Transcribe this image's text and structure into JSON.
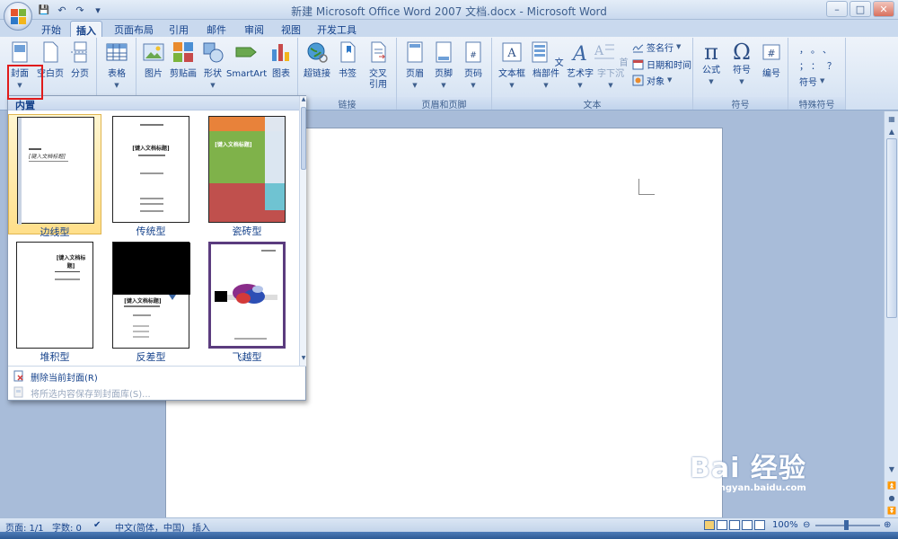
{
  "window": {
    "title": "新建 Microsoft Office Word 2007 文档.docx - Microsoft Word",
    "minimize": "–",
    "maximize": "□",
    "close": "✕"
  },
  "qat": {
    "save": "💾",
    "undo": "↶",
    "redo": "↷",
    "customize": "▾"
  },
  "tabs": [
    {
      "label": "开始"
    },
    {
      "label": "插入"
    },
    {
      "label": "页面布局"
    },
    {
      "label": "引用"
    },
    {
      "label": "邮件"
    },
    {
      "label": "审阅"
    },
    {
      "label": "视图"
    },
    {
      "label": "开发工具"
    }
  ],
  "active_tab": "插入",
  "ribbon": {
    "pages": {
      "cover": "封面",
      "blank": "空白页",
      "break": "分页"
    },
    "tables": {
      "label": "表格",
      "group": "表格"
    },
    "illustrations": {
      "picture": "图片",
      "clipart": "剪贴画",
      "shapes": "形状",
      "smartart": "SmartArt",
      "chart": "图表"
    },
    "links": {
      "hyperlink": "超链接",
      "bookmark": "书签",
      "crossref_1": "交叉",
      "crossref_2": "引用",
      "group": "链接"
    },
    "header_footer": {
      "header": "页眉",
      "footer": "页脚",
      "page_number": "页码",
      "group": "页眉和页脚"
    },
    "text": {
      "textbox": "文本框",
      "quickparts": "文档部件",
      "wordart": "艺术字",
      "dropcap": "首字下沉",
      "signature": "签名行",
      "datetime": "日期和时间",
      "object": "对象",
      "group": "文本"
    },
    "symbols": {
      "equation": "公式",
      "symbol": "符号",
      "number": "编号",
      "group": "符号"
    },
    "special": {
      "row1": "，。、",
      "row2": "；：？",
      "symbol_dd": "符号",
      "group": "特殊符号"
    }
  },
  "gallery": {
    "header": "内置",
    "items": [
      {
        "label": "边线型",
        "selected": true
      },
      {
        "label": "传统型",
        "selected": false
      },
      {
        "label": "瓷砖型",
        "selected": false
      },
      {
        "label": "堆积型",
        "selected": false
      },
      {
        "label": "反差型",
        "selected": false
      },
      {
        "label": "飞越型",
        "selected": false
      }
    ],
    "thumb_titles": {
      "sideline": "[键入文档标题]",
      "traditional": "[键入文档标题]",
      "tiles": "[键入文档标题]",
      "stacks": "[键入文档标题]",
      "contrast": "[键入文档标题]"
    },
    "remove_cover": "删除当前封面(R)",
    "save_selection": "将所选内容保存到封面库(S)..."
  },
  "statusbar": {
    "page": "页面: 1/1",
    "words": "字数: 0",
    "language": "中文(简体，中国)",
    "mode": "插入",
    "zoom": "100%"
  },
  "watermark": {
    "main": "Bai 经验",
    "sub": "jingyan.baidu.com"
  },
  "colors": {
    "tile_orange": "#e8823a",
    "tile_green": "#7fb24a",
    "tile_red": "#c0504d",
    "tile_cyan": "#6fc3d2",
    "highlight_red": "#e01b1b"
  }
}
